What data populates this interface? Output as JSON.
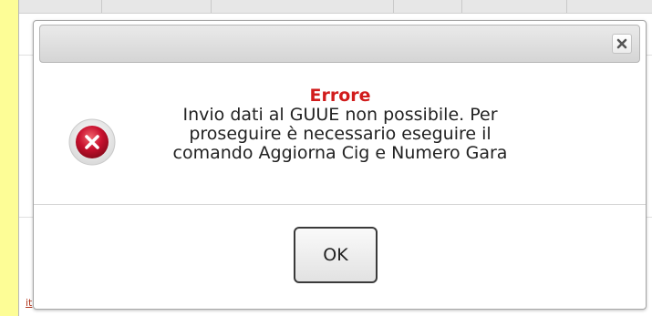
{
  "background": {
    "link_text": "it"
  },
  "dialog": {
    "close_icon": "close-icon",
    "status_icon": "error-icon",
    "title": "Errore",
    "message_lines": [
      "Invio dati al GUUE non possibile. Per",
      "proseguire è necessario eseguire il",
      "comando Aggiorna Cig e Numero Gara"
    ],
    "ok_label": "OK"
  },
  "colors": {
    "page_background": "#fdfd96",
    "error_title": "#d11d1d",
    "error_icon": "#c8102e"
  }
}
